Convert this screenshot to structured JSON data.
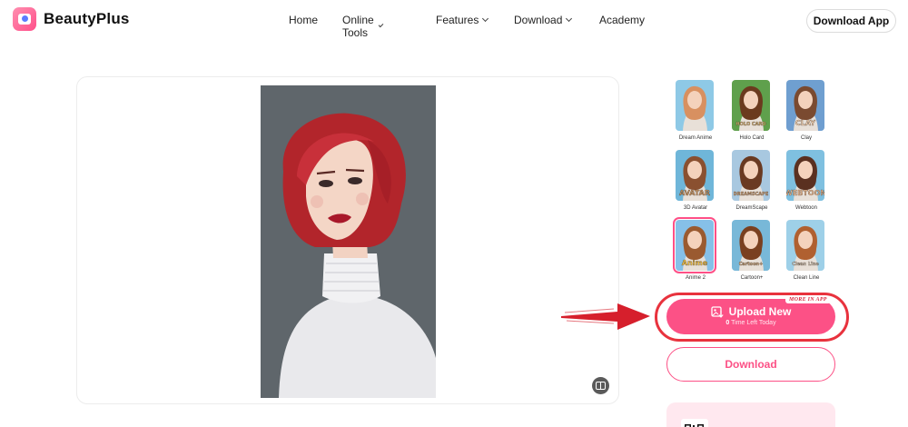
{
  "brand": {
    "name": "BeautyPlus"
  },
  "nav": {
    "items": [
      {
        "label": "Home",
        "dropdown": false
      },
      {
        "label": "Online Tools",
        "dropdown": true
      },
      {
        "label": "Features",
        "dropdown": true
      },
      {
        "label": "Download",
        "dropdown": true
      },
      {
        "label": "Academy",
        "dropdown": false
      }
    ],
    "cta": "Download App"
  },
  "styles": [
    {
      "label": "Dream Anime",
      "badge": ""
    },
    {
      "label": "Holo Card",
      "badge": "HOLO CARD"
    },
    {
      "label": "Clay",
      "badge": "CLAY"
    },
    {
      "label": "3D Avatar",
      "badge": "AVATAR"
    },
    {
      "label": "DreamScape",
      "badge": "DREAMSCAPE"
    },
    {
      "label": "Webtoon",
      "badge": "WEBTOON"
    },
    {
      "label": "Anime 2",
      "badge": "Anime",
      "active": true
    },
    {
      "label": "Cartoon+",
      "badge": "Cartoon+"
    },
    {
      "label": "Clean Line",
      "badge": "Clean Line"
    }
  ],
  "upload": {
    "label": "Upload New",
    "count": "0",
    "sub": "Time Left Today",
    "badge": "MORE IN APP"
  },
  "download": {
    "label": "Download"
  },
  "colors": {
    "accent": "#fc5186",
    "highlight": "#e8323d"
  }
}
